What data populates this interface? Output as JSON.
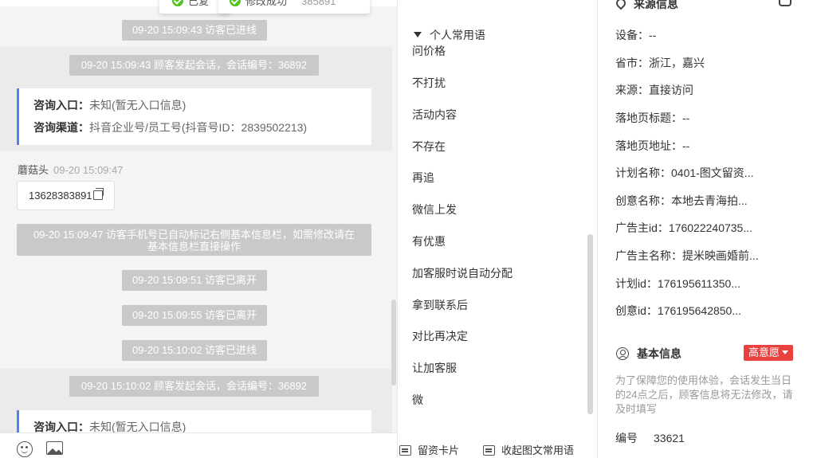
{
  "toasts": [
    "已复",
    "修改成功",
    "385891"
  ],
  "chat": {
    "messages": {
      "m1": "09-20 15:09:43 访客已进线",
      "m2": "09-20 15:09:43 顾客发起会话，会话编号：36892",
      "card1_entry_label": "咨询入口：",
      "card1_entry_value": "未知(暂无入口信息)",
      "card1_channel_label": "咨询渠道：",
      "card1_channel_value": "抖音企业号/员工号(抖音号ID：2839502213)",
      "sender_name": "蘑菇头",
      "sender_time": "09-20 15:09:47",
      "phone": "13628383891",
      "notice_line1": "09-20 15:09:47 访客手机号已自动标记右侧基本信息栏，如需修改请在",
      "notice_line2": "基本信息栏直接操作",
      "m3": "09-20 15:09:51 访客已离开",
      "m4": "09-20 15:09:55 访客已离开",
      "m5": "09-20 15:10:02 访客已进线",
      "m6": "09-20 15:10:02 顾客发起会话，会话编号：36892",
      "card2_entry_label": "咨询入口：",
      "card2_entry_value": "未知(暂无入口信息)"
    }
  },
  "phrases": {
    "header": "个人常用语",
    "items": [
      "问价格",
      "不打扰",
      "活动内容",
      "不存在",
      "再追",
      "微信上发",
      "有优惠",
      "加客服时说自动分配",
      "拿到联系后",
      "对比再决定",
      "让加客服",
      "微"
    ],
    "bottom_left": "留资卡片",
    "bottom_right": "收起图文常用语"
  },
  "info": {
    "source_title": "来源信息",
    "source": [
      {
        "label": "设备：",
        "value": "--"
      },
      {
        "label": "省市：",
        "value": "浙江，嘉兴"
      },
      {
        "label": "来源：",
        "value": "直接访问"
      },
      {
        "label": "落地页标题：",
        "value": "--"
      },
      {
        "label": "落地页地址：",
        "value": "--"
      },
      {
        "label": "计划名称：",
        "value": "0401-图文留资..."
      },
      {
        "label": "创意名称：",
        "value": "本地去青海拍..."
      },
      {
        "label": "广告主id：",
        "value": "176022240735..."
      },
      {
        "label": "广告主名称：",
        "value": "提米映画婚前..."
      },
      {
        "label": "计划id：",
        "value": "176195611350..."
      },
      {
        "label": "创意id：",
        "value": "176195642850..."
      }
    ],
    "basic_title": "基本信息",
    "intent_badge": "高意愿",
    "basic_notice": "为了保障您的使用体验，会话发生当日的24点之后，顾客信息将无法修改，请及时填写",
    "number_label": "编号",
    "number_value": "33621"
  },
  "colors": {
    "accent_blue": "#4d86e8",
    "badge_red": "#e8413f",
    "success_green": "#52c41a",
    "system_pill": "#c9c9c9"
  }
}
